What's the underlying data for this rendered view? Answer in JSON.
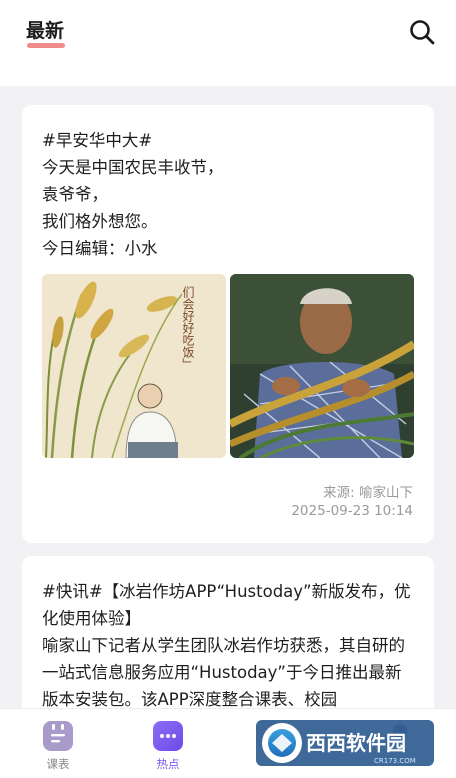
{
  "header": {
    "active_tab": "最新",
    "search_icon": "search-icon",
    "accent_color": "#f08a8c"
  },
  "feed": {
    "posts": [
      {
        "lines": [
          "#早安华中大#",
          "今天是中国农民丰收节，",
          "袁爷爷，",
          "我们格外想您。",
          "今日编辑：小水"
        ],
        "image_text": "们会好好吃饭」",
        "source": "来源: 喻家山下",
        "time": "2025-09-23 10:14"
      },
      {
        "lines": [
          "#快讯#【冰岩作坊APP“Hustoday”新版发布，优化使用体验】",
          "喻家山下记者从学生团队冰岩作坊获悉，其自研的一站式信息服务应用“Hustoday”于今日推出最新版本安装包。该APP深度整合课表、校园"
        ]
      }
    ]
  },
  "tabbar": {
    "items": [
      {
        "label": "课表",
        "icon": "calendar-icon"
      },
      {
        "label": "热点",
        "icon": "chat-bubble-icon",
        "active": true
      },
      {
        "label": "",
        "icon": "broadcast-icon"
      },
      {
        "label": "",
        "icon": "profile-icon"
      }
    ],
    "active_color": "#7b5bf0"
  },
  "watermark": {
    "text": "西西软件园",
    "sub": "CR173.COM"
  }
}
